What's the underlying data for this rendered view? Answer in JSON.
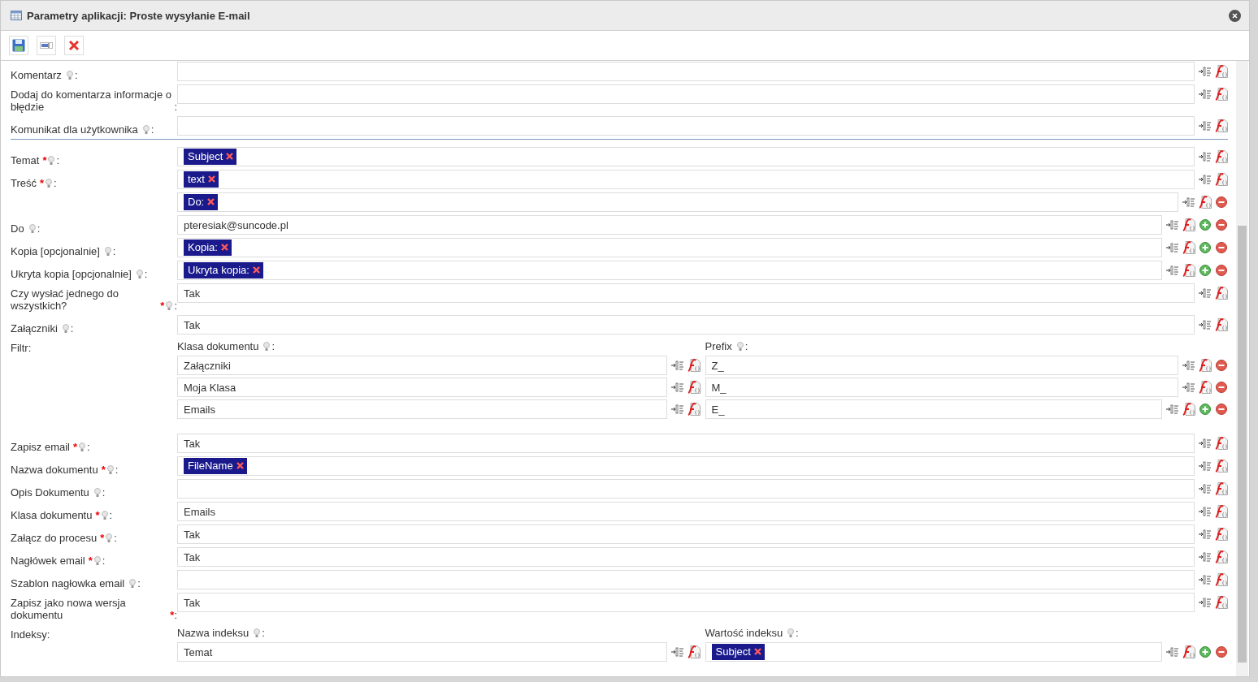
{
  "window": {
    "title": "Parametry aplikacji: Proste wysyłanie E-mail"
  },
  "sections": [
    {
      "rows": [
        {
          "kind": "single",
          "label": "Komentarz",
          "hint": true,
          "suffix": ":",
          "entries": [
            {
              "kind": "text",
              "add": false,
              "remove": false
            }
          ]
        },
        {
          "kind": "single",
          "label": "Dodaj do komentarza informacje o błędzie",
          "hint": false,
          "suffix": ":",
          "entries": [
            {
              "kind": "text",
              "add": false,
              "remove": false
            }
          ]
        },
        {
          "kind": "single",
          "label": "Komunikat dla użytkownika",
          "hint": true,
          "suffix": ":",
          "entries": [
            {
              "kind": "text",
              "add": false,
              "remove": false
            }
          ]
        }
      ]
    },
    {
      "rows": [
        {
          "kind": "single",
          "label": "Temat",
          "required": "*",
          "hint": true,
          "suffix": ":",
          "entries": [
            {
              "kind": "token",
              "value": "Subject",
              "add": false,
              "remove": false
            }
          ]
        },
        {
          "kind": "single",
          "label": "Treść",
          "required": "*",
          "hint": true,
          "suffix": ":",
          "entries": [
            {
              "kind": "token",
              "value": "text",
              "add": false,
              "remove": false
            }
          ]
        },
        {
          "kind": "single",
          "label": "Do",
          "hint": true,
          "suffix": ":",
          "entries": [
            {
              "kind": "token",
              "value": "Do:",
              "add": false,
              "remove": true
            },
            {
              "kind": "text",
              "value": "pteresiak@suncode.pl",
              "add": true,
              "remove": true
            }
          ]
        },
        {
          "kind": "single",
          "label": "Kopia [opcjonalnie]",
          "hint": true,
          "suffix": ":",
          "entries": [
            {
              "kind": "token",
              "value": "Kopia:",
              "add": true,
              "remove": true
            }
          ]
        },
        {
          "kind": "single",
          "label": "Ukryta kopia [opcjonalnie]",
          "hint": true,
          "suffix": ":",
          "entries": [
            {
              "kind": "token",
              "value": "Ukryta kopia:",
              "add": true,
              "remove": true
            }
          ]
        },
        {
          "kind": "single",
          "label": "Czy wysłać jednego do wszystkich?",
          "required": "*",
          "hint": true,
          "suffix": ":",
          "entries": [
            {
              "kind": "text",
              "value": "Tak",
              "add": false,
              "remove": false
            }
          ]
        },
        {
          "kind": "single",
          "label": "Załączniki",
          "hint": true,
          "suffix": ":",
          "entries": [
            {
              "kind": "text",
              "value": "Tak",
              "add": false,
              "remove": false
            }
          ]
        },
        {
          "kind": "grid",
          "label": "Filtr",
          "hint": false,
          "suffix": ":",
          "columns": [
            {
              "header": "Klasa dokumentu",
              "hint": true,
              "suffix": ":",
              "cells": [
                {
                  "kind": "text",
                  "value": "Załączniki",
                  "add": false,
                  "remove": false
                },
                {
                  "kind": "text",
                  "value": "Moja Klasa",
                  "add": false,
                  "remove": false
                },
                {
                  "kind": "text",
                  "value": "Emails",
                  "add": false,
                  "remove": false
                }
              ]
            },
            {
              "header": "Prefix",
              "hint": true,
              "suffix": ":",
              "cells": [
                {
                  "kind": "text",
                  "value": "Z_",
                  "add": false,
                  "remove": true
                },
                {
                  "kind": "text",
                  "value": "M_",
                  "add": false,
                  "remove": true
                },
                {
                  "kind": "text",
                  "value": "E_",
                  "add": true,
                  "remove": true
                }
              ]
            }
          ]
        },
        {
          "kind": "single",
          "label": "Zapisz email",
          "required": "*",
          "hint": true,
          "suffix": ":",
          "entries": [
            {
              "kind": "text",
              "value": "Tak",
              "add": false,
              "remove": false
            }
          ]
        },
        {
          "kind": "single",
          "label": "Nazwa dokumentu",
          "required": "*",
          "hint": true,
          "suffix": ":",
          "entries": [
            {
              "kind": "token",
              "value": "FileName",
              "add": false,
              "remove": false
            }
          ]
        },
        {
          "kind": "single",
          "label": "Opis Dokumentu",
          "hint": true,
          "suffix": ":",
          "entries": [
            {
              "kind": "text",
              "add": false,
              "remove": false
            }
          ]
        },
        {
          "kind": "single",
          "label": "Klasa dokumentu",
          "required": "*",
          "hint": true,
          "suffix": ":",
          "entries": [
            {
              "kind": "text",
              "value": "Emails",
              "add": false,
              "remove": false
            }
          ]
        },
        {
          "kind": "single",
          "label": "Załącz do procesu",
          "required": "*",
          "hint": true,
          "suffix": ":",
          "entries": [
            {
              "kind": "text",
              "value": "Tak",
              "add": false,
              "remove": false
            }
          ]
        },
        {
          "kind": "single",
          "label": "Nagłówek email",
          "required": "*",
          "hint": true,
          "suffix": ":",
          "entries": [
            {
              "kind": "text",
              "value": "Tak",
              "add": false,
              "remove": false
            }
          ]
        },
        {
          "kind": "single",
          "label": "Szablon nagłowka email",
          "hint": true,
          "suffix": ":",
          "entries": [
            {
              "kind": "text",
              "add": false,
              "remove": false
            }
          ]
        },
        {
          "kind": "single",
          "label": "Zapisz jako nowa wersja dokumentu",
          "required": "*",
          "hint": false,
          "suffix": ":",
          "entries": [
            {
              "kind": "text",
              "value": "Tak",
              "add": false,
              "remove": false
            }
          ]
        },
        {
          "kind": "grid",
          "label": "Indeksy",
          "hint": false,
          "suffix": ":",
          "columns": [
            {
              "header": "Nazwa indeksu",
              "hint": true,
              "suffix": ":",
              "cells": [
                {
                  "kind": "text",
                  "value": "Temat",
                  "add": false,
                  "remove": false
                }
              ]
            },
            {
              "header": "Wartość indeksu",
              "hint": true,
              "suffix": ":",
              "cells": [
                {
                  "kind": "token",
                  "value": "Subject",
                  "add": true,
                  "remove": true
                }
              ]
            }
          ]
        }
      ]
    }
  ]
}
